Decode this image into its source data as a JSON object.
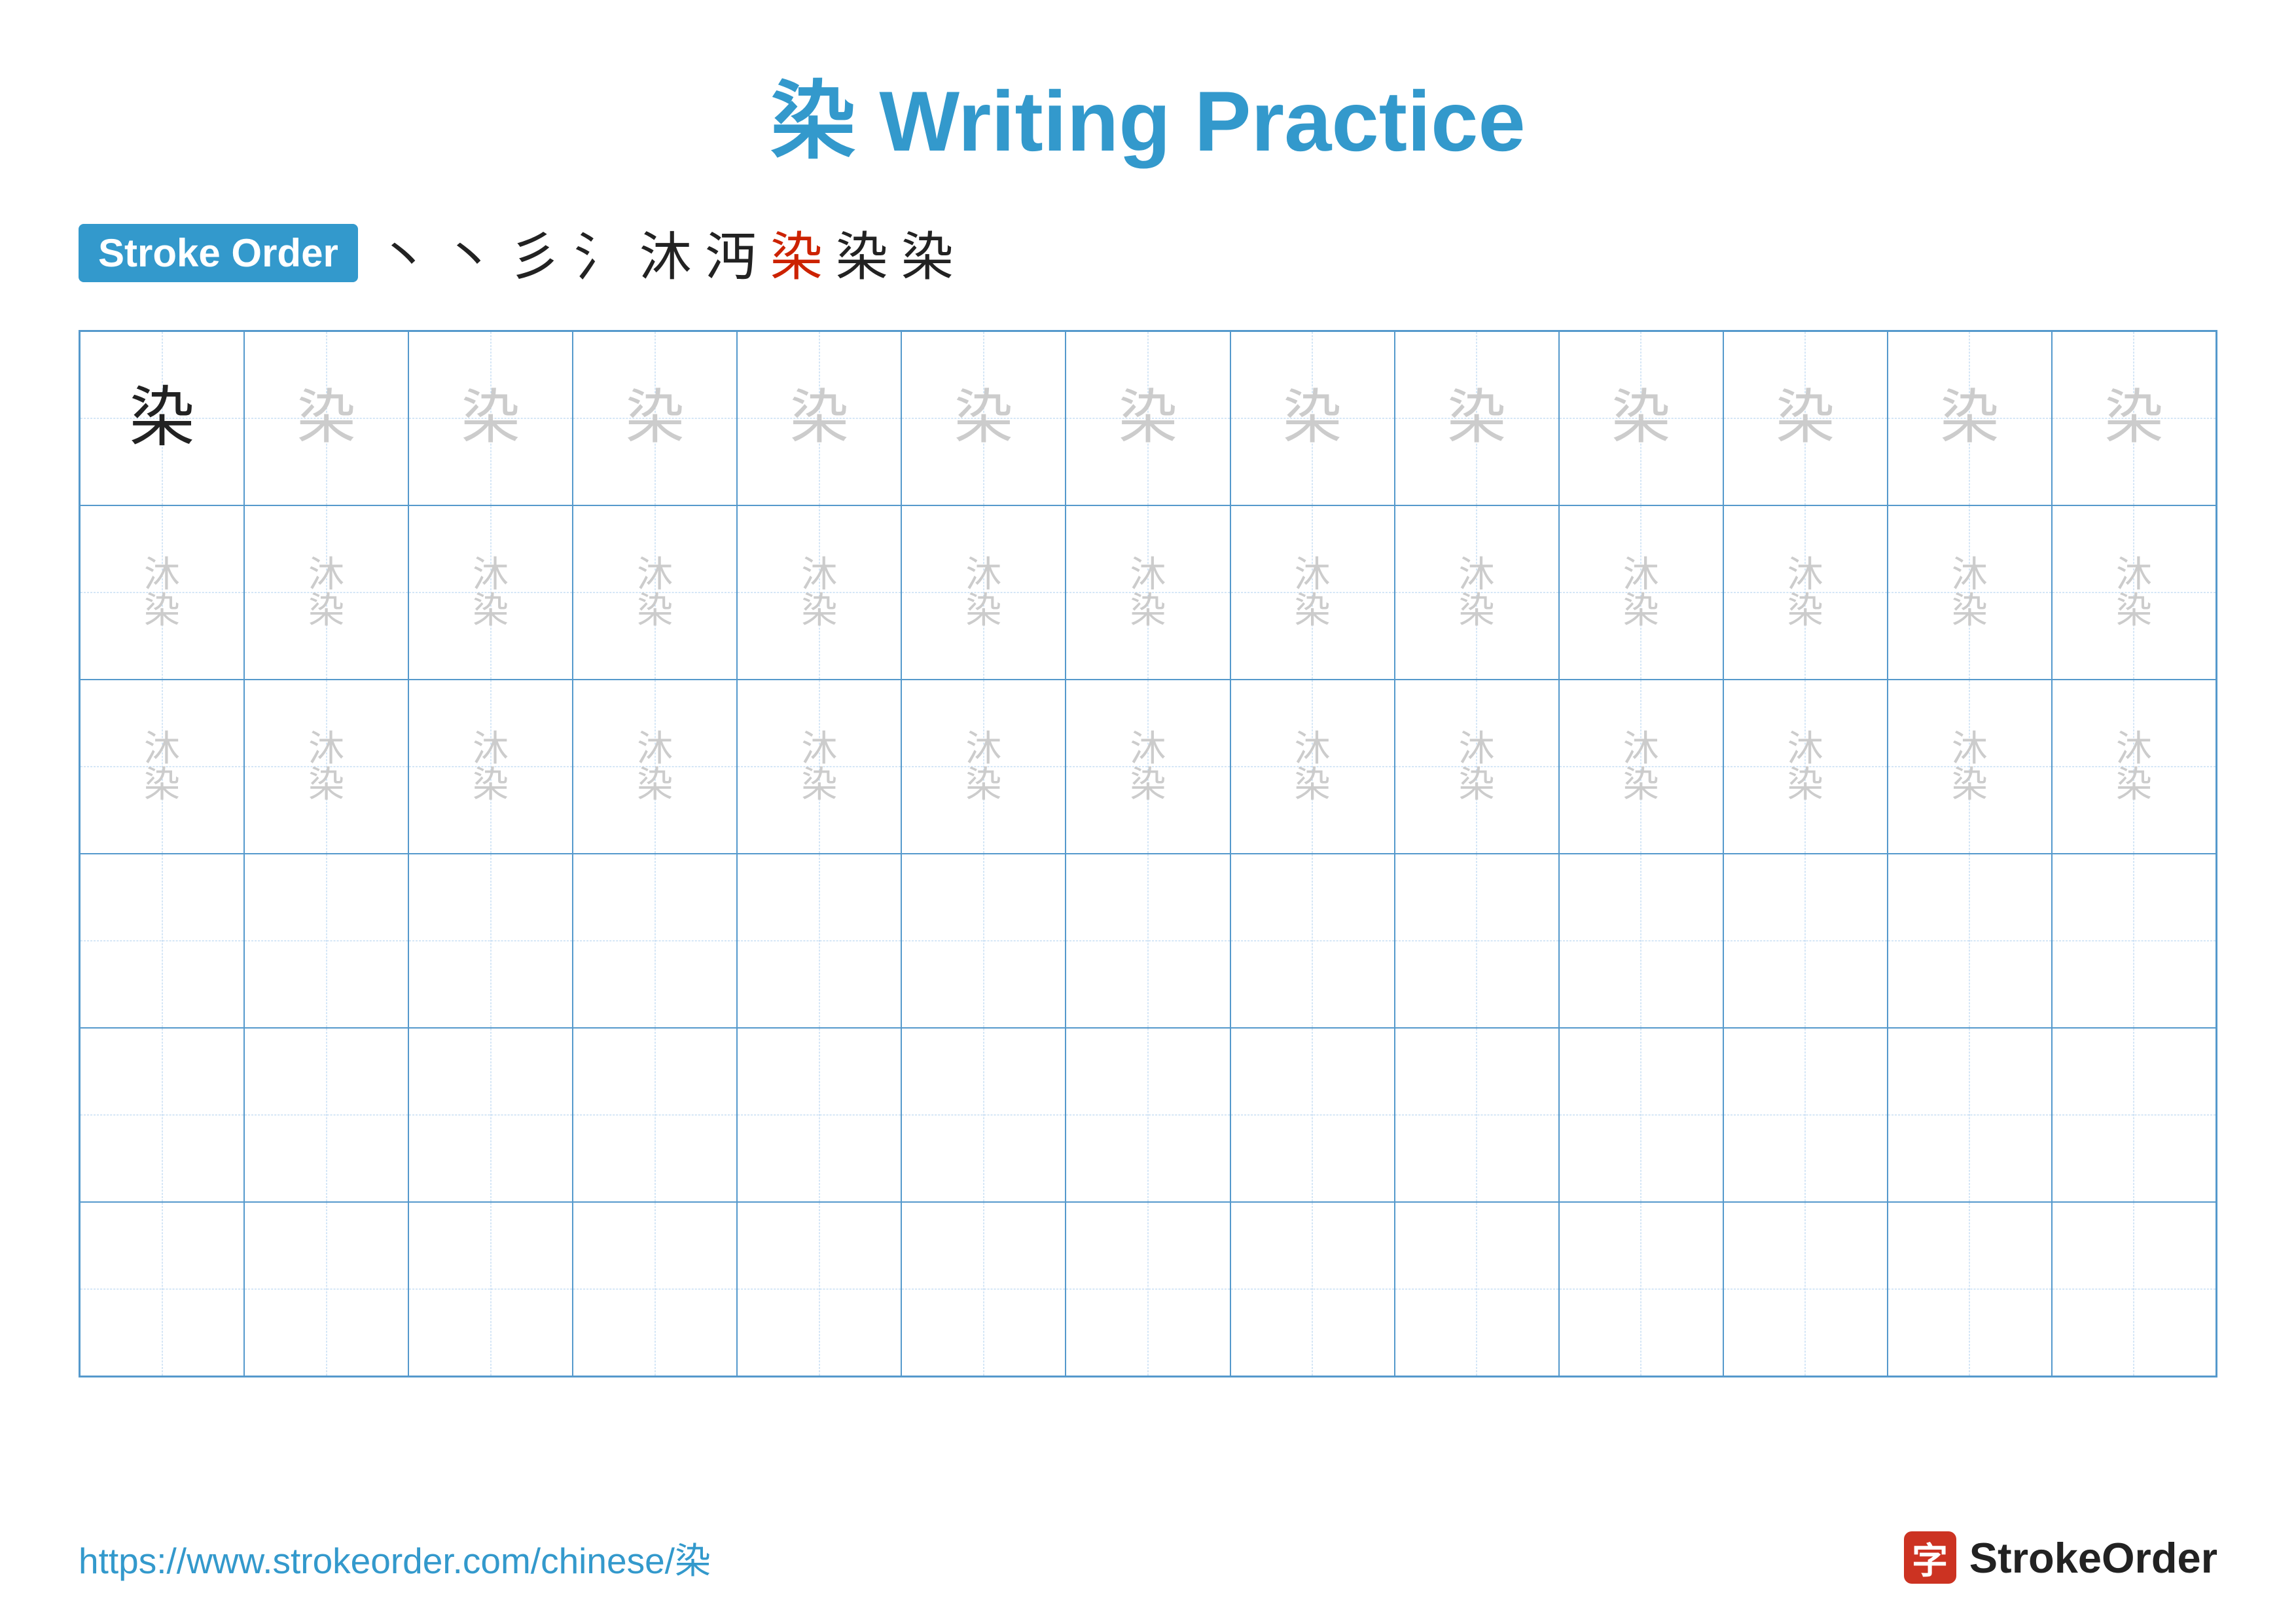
{
  "title": {
    "char": "染",
    "text": " Writing Practice"
  },
  "stroke_order": {
    "badge_label": "Stroke Order",
    "strokes": [
      "丶",
      "丶",
      "彡",
      "氵",
      "沐",
      "沔",
      "染",
      "染",
      "染"
    ]
  },
  "grid": {
    "rows": 6,
    "cols": 13,
    "cells": [
      {
        "row": 0,
        "col": 0,
        "char": "染",
        "style": "dark"
      },
      {
        "row": 0,
        "col": 1,
        "char": "染",
        "style": "light"
      },
      {
        "row": 0,
        "col": 2,
        "char": "染",
        "style": "light"
      },
      {
        "row": 0,
        "col": 3,
        "char": "染",
        "style": "light"
      },
      {
        "row": 0,
        "col": 4,
        "char": "染",
        "style": "light"
      },
      {
        "row": 0,
        "col": 5,
        "char": "染",
        "style": "light"
      },
      {
        "row": 0,
        "col": 6,
        "char": "染",
        "style": "light"
      },
      {
        "row": 0,
        "col": 7,
        "char": "染",
        "style": "light"
      },
      {
        "row": 0,
        "col": 8,
        "char": "染",
        "style": "light"
      },
      {
        "row": 0,
        "col": 9,
        "char": "染",
        "style": "light"
      },
      {
        "row": 0,
        "col": 10,
        "char": "染",
        "style": "light"
      },
      {
        "row": 0,
        "col": 11,
        "char": "染",
        "style": "light"
      },
      {
        "row": 0,
        "col": 12,
        "char": "染",
        "style": "light"
      }
    ]
  },
  "footer": {
    "url": "https://www.strokeorder.com/chinese/染",
    "brand_icon": "字",
    "brand_name": "StrokeOrder"
  }
}
